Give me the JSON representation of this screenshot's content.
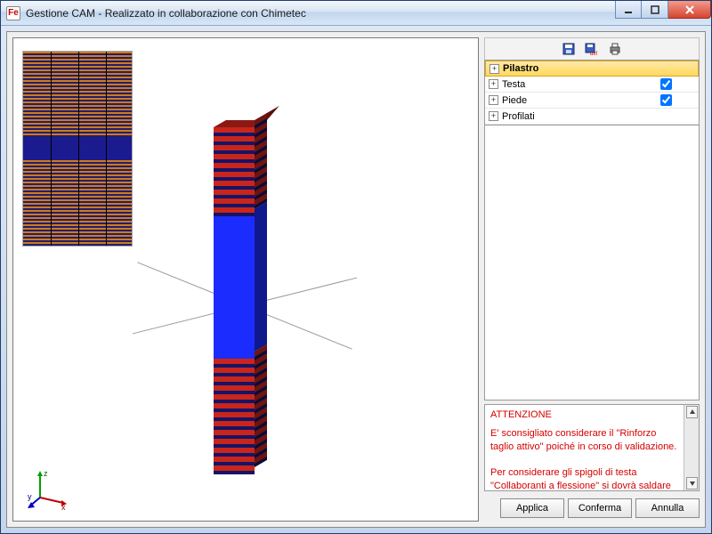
{
  "window": {
    "title": "Gestione CAM - Realizzato in collaborazione con Chimetec",
    "app_icon_text": "Fe"
  },
  "toolbar": {
    "icons": [
      "save-icon",
      "save-as-icon",
      "print-icon"
    ]
  },
  "tree": {
    "items": [
      {
        "label": "Pilastro",
        "selected": true,
        "checkbox": false,
        "checked": false
      },
      {
        "label": "Testa",
        "selected": false,
        "checkbox": true,
        "checked": true
      },
      {
        "label": "Piede",
        "selected": false,
        "checkbox": true,
        "checked": true
      },
      {
        "label": "Profilati",
        "selected": false,
        "checkbox": false,
        "checked": false
      }
    ]
  },
  "warning": {
    "heading": "ATTENZIONE",
    "line1": "E' sconsigliato considerare il \"Rinforzo taglio attivo\" poiché in corso di validazione.",
    "line2": "Per considerare gli spigoli di testa \"Collaboranti a flessione\" si dovrà saldare"
  },
  "buttons": {
    "apply": "Applica",
    "confirm": "Conferma",
    "cancel": "Annulla"
  },
  "axis": {
    "x": "x",
    "y": "y",
    "z": "z"
  }
}
